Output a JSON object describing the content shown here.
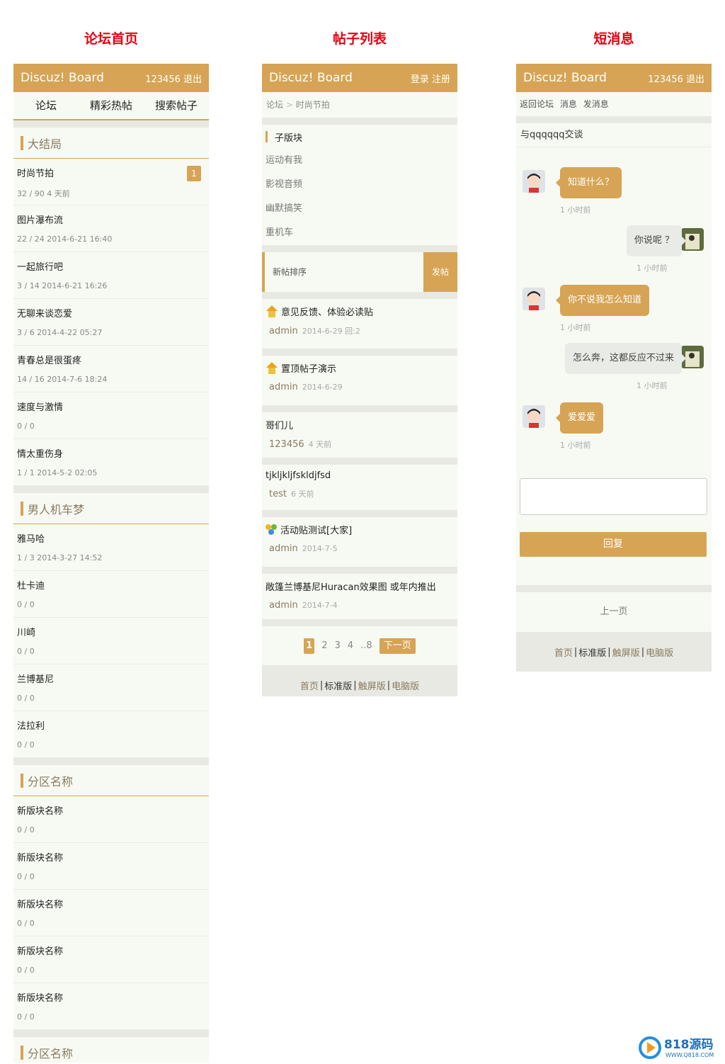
{
  "titles": {
    "home": "论坛首页",
    "list": "帖子列表",
    "pm": "短消息"
  },
  "brand": "Discuz! Board",
  "home": {
    "user": "123456 退出",
    "nav": [
      "论坛",
      "精彩热帖",
      "搜索帖子"
    ],
    "sections": [
      {
        "name": "大结局",
        "forums": [
          {
            "name": "时尚节拍",
            "meta": "32 / 90   4 天前",
            "badge": "1"
          },
          {
            "name": "图片瀑布流",
            "meta": "22 / 24   2014-6-21 16:40"
          },
          {
            "name": "一起旅行吧",
            "meta": "3 / 14   2014-6-21 16:26"
          },
          {
            "name": "无聊来谈恋爱",
            "meta": "3 / 6   2014-4-22 05:27"
          },
          {
            "name": "青春总是很蛋疼",
            "meta": "14 / 16   2014-7-6 18:24"
          },
          {
            "name": "速度与激情",
            "meta": "0 / 0"
          },
          {
            "name": "情太重伤身",
            "meta": "1 / 1   2014-5-2 02:05"
          }
        ]
      },
      {
        "name": "男人机车梦",
        "forums": [
          {
            "name": "雅马哈",
            "meta": "1 / 3   2014-3-27 14:52"
          },
          {
            "name": "杜卡迪",
            "meta": "0 / 0"
          },
          {
            "name": "川崎",
            "meta": "0 / 0"
          },
          {
            "name": "兰博基尼",
            "meta": "0 / 0"
          },
          {
            "name": "法拉利",
            "meta": "0 / 0"
          }
        ]
      },
      {
        "name": "分区名称",
        "forums": [
          {
            "name": "新版块名称",
            "meta": "0 / 0"
          },
          {
            "name": "新版块名称",
            "meta": "0 / 0"
          },
          {
            "name": "新版块名称",
            "meta": "0 / 0"
          },
          {
            "name": "新版块名称",
            "meta": "0 / 0"
          },
          {
            "name": "新版块名称",
            "meta": "0 / 0"
          }
        ]
      },
      {
        "name": "分区名称",
        "forums": []
      }
    ]
  },
  "list": {
    "user": "登录 注册",
    "crumb_root": "论坛",
    "crumb_sep": " > ",
    "crumb_cur": "时尚节拍",
    "sub_title": "子版块",
    "subforums": [
      "运动有我",
      "影视音频",
      "幽默搞笑",
      "重机车"
    ],
    "sort_label": "新帖排序",
    "post_btn": "发帖",
    "threads": [
      {
        "icon": "up",
        "title": "意见反馈、体验必读贴",
        "author": "admin",
        "date": "2014-6-29 回:2"
      },
      {
        "icon": "up",
        "title": "置顶帖子演示",
        "author": "admin",
        "date": "2014-6-29"
      },
      {
        "icon": "",
        "title": "哥们儿",
        "author": "123456",
        "date": "4 天前"
      },
      {
        "icon": "",
        "title": "tjkljkljfskldjfsd",
        "author": "test",
        "date": "6 天前"
      },
      {
        "icon": "group",
        "title": "活动贴测试[大家]",
        "author": "admin",
        "date": "2014-7-5"
      },
      {
        "icon": "",
        "title": "敞篷兰博基尼Huracan效果图 或年内推出",
        "author": "admin",
        "date": "2014-7-4"
      }
    ],
    "pages": [
      "1",
      "2",
      "3",
      "4",
      "..8"
    ],
    "next": "下一页"
  },
  "footer": {
    "home": "首页",
    "std": "标准版",
    "touch": "触屏版",
    "pc": "电脑版",
    "sep": "|"
  },
  "pm": {
    "user": "123456 退出",
    "nav": [
      "返回论坛",
      "消息",
      "发消息"
    ],
    "conv": "与qqqqqq交谈",
    "messages": [
      {
        "side": "in",
        "text": "知道什么？",
        "time": "1 小时前"
      },
      {
        "side": "out",
        "text": "你说呢 ？",
        "time": "1 小时前"
      },
      {
        "side": "in",
        "text": "你不说我怎么知道",
        "time": "1 小时前"
      },
      {
        "side": "out",
        "text": "怎么奔，这都反应不过来",
        "time": "1 小时前"
      },
      {
        "side": "in",
        "text": "爱爱爱",
        "time": "1 小时前"
      }
    ],
    "reply": "回复",
    "prev": "上一页"
  },
  "watermark": {
    "text": "818源码",
    "url": "WWW.Q818.COM"
  },
  "colors": {
    "accent": "#d6a454",
    "bg": "#f7faf3",
    "title_red": "#e60012"
  }
}
